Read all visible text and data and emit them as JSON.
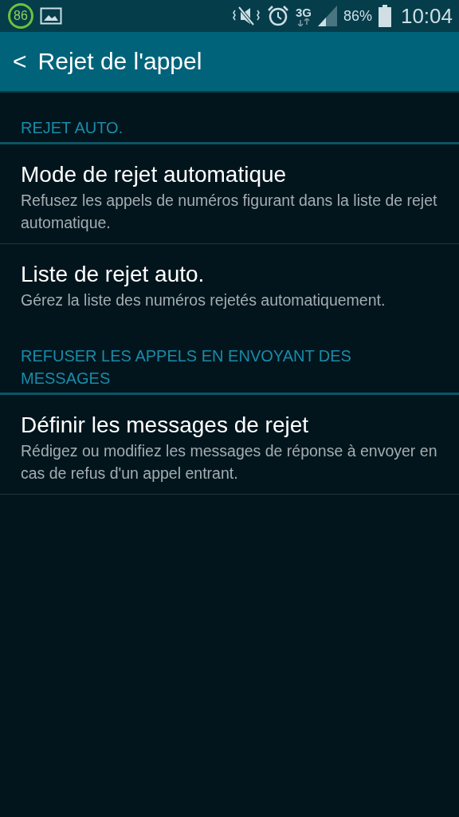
{
  "status_bar": {
    "notification_badge": "86",
    "signal_type": "3G",
    "battery": "86%",
    "time": "10:04"
  },
  "action_bar": {
    "back": "<",
    "title": "Rejet de l'appel"
  },
  "sections": [
    {
      "header": "REJET AUTO.",
      "items": [
        {
          "title": "Mode de rejet automatique",
          "summary": "Refusez les appels de numéros figurant dans la liste de rejet automatique."
        },
        {
          "title": "Liste de rejet auto.",
          "summary": "Gérez la liste des numéros rejetés automatiquement."
        }
      ]
    },
    {
      "header": "REFUSER LES APPELS EN ENVOYANT DES MESSAGES",
      "items": [
        {
          "title": "Définir les messages de rejet",
          "summary": "Rédigez ou modifiez les messages de réponse à envoyer en cas de refus d'un appel entrant."
        }
      ]
    }
  ]
}
